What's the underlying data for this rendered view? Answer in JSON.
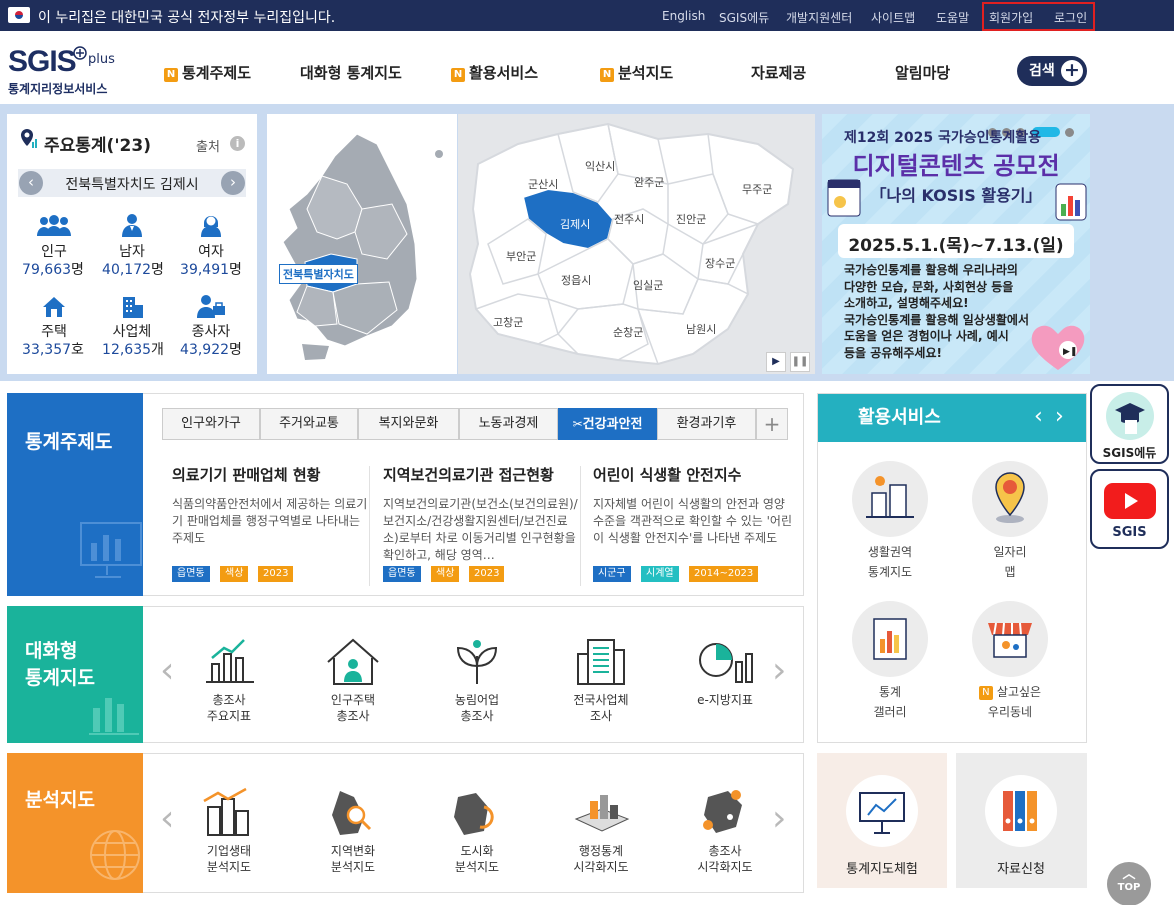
{
  "gov_banner": {
    "text": "이 누리집은 대한민국 공식 전자정부 누리집입니다."
  },
  "top_links": [
    "English",
    "SGIS에듀",
    "개발지원센터",
    "사이트맵",
    "도움말",
    "회원가입",
    "로그인"
  ],
  "logo": {
    "name": "SGIS",
    "plus": "plus",
    "subtitle": "통계지리정보서비스"
  },
  "nav": {
    "items": [
      {
        "label": "통계주제도",
        "badge": "N"
      },
      {
        "label": "대화형 통계지도",
        "badge": ""
      },
      {
        "label": "활용서비스",
        "badge": "N"
      },
      {
        "label": "분석지도",
        "badge": "N"
      },
      {
        "label": "자료제공",
        "badge": ""
      },
      {
        "label": "알림마당",
        "badge": ""
      }
    ],
    "search_label": "검색"
  },
  "stats": {
    "title": "주요통계('23)",
    "source_label": "출처",
    "info_icon": "i",
    "region": "전북특별자치도 김제시",
    "items": [
      {
        "label": "인구",
        "value": "79,663",
        "unit": "명"
      },
      {
        "label": "남자",
        "value": "40,172",
        "unit": "명"
      },
      {
        "label": "여자",
        "value": "39,491",
        "unit": "명"
      },
      {
        "label": "주택",
        "value": "33,357",
        "unit": "호"
      },
      {
        "label": "사업체",
        "value": "12,635",
        "unit": "개"
      },
      {
        "label": "종사자",
        "value": "43,922",
        "unit": "명"
      }
    ]
  },
  "map": {
    "korea_label": "전북특별자치도",
    "districts": [
      "군산시",
      "익산시",
      "완주군",
      "무주군",
      "김제시",
      "전주시",
      "진안군",
      "부안군",
      "장수군",
      "정읍시",
      "임실군",
      "고창군",
      "순창군",
      "남원시"
    ],
    "selected": "김제시"
  },
  "promo": {
    "line1": "제12회 2025 국가승인통계활용",
    "line2": "디지털콘텐츠 공모전",
    "line3": "「나의 KOSIS 활용기」",
    "date": "2025.5.1.(목)~7.13.(일)",
    "body": [
      "국가승인통계를 활용해 우리나라의",
      "다양한 모습, 문화, 사회현상 등을",
      "소개하고, 설명해주세요!",
      "국가승인통계를 활용해 일상생활에서",
      "도움을 얻은 경험이나 사례, 예시",
      "등을 공유해주세요!"
    ]
  },
  "theme": {
    "side_title": "통계주제도",
    "tabs": [
      "인구와가구",
      "주거와교통",
      "복지와문화",
      "노동과경제",
      "건강과안전",
      "환경과기후",
      "+"
    ],
    "cards": [
      {
        "title": "의료기기 판매업체 현황",
        "desc": "식품의약품안전처에서 제공하는 의료기기 판매업체를 행정구역별로 나타내는 주제도",
        "tags": [
          "읍면동",
          "색상",
          "2023"
        ]
      },
      {
        "title": "지역보건의료기관 접근현황",
        "desc": "지역보건의료기관(보건소(보건의료원)/보건지소/건강생활지원센터/보건진료소)로부터 차로 이동거리별 인구현황을 확인하고, 해당 영역…",
        "tags": [
          "읍면동",
          "색상",
          "2023"
        ]
      },
      {
        "title": "어린이 식생활 안전지수",
        "desc": "지자체별 어린이 식생활의 안전과 영양수준을 객관적으로 확인할 수 있는 '어린이 식생활 안전지수'를 나타낸 주제도",
        "tags": [
          "시군구",
          "시계열",
          "2014~2023"
        ]
      }
    ]
  },
  "interactive": {
    "side_title": [
      "대화형",
      "통계지도"
    ],
    "items": [
      [
        "총조사",
        "주요지표"
      ],
      [
        "인구주택",
        "총조사"
      ],
      [
        "농림어업",
        "총조사"
      ],
      [
        "전국사업체",
        "조사"
      ],
      [
        "e-지방지표",
        ""
      ]
    ]
  },
  "analysis": {
    "side_title": "분석지도",
    "items": [
      [
        "기업생태",
        "분석지도"
      ],
      [
        "지역변화",
        "분석지도"
      ],
      [
        "도시화",
        "분석지도"
      ],
      [
        "행정통계",
        "시각화지도"
      ],
      [
        "총조사",
        "시각화지도"
      ]
    ]
  },
  "services": {
    "title": "활용서비스",
    "items": [
      {
        "label": [
          "생활권역",
          "통계지도"
        ],
        "badge": ""
      },
      {
        "label": [
          "일자리",
          "맵"
        ],
        "badge": ""
      },
      {
        "label": [
          "통계",
          "갤러리"
        ],
        "badge": ""
      },
      {
        "label": [
          "살고싶은",
          "우리동네"
        ],
        "badge": "N"
      }
    ]
  },
  "tiles": [
    "통계지도체험",
    "자료신청"
  ],
  "floating": {
    "edu": "SGIS에듀",
    "youtube": "SGIS",
    "top": "TOP"
  },
  "colors": {
    "navy": "#1f2e5a",
    "blue": "#1e6fc4",
    "teal": "#1ab39b",
    "orange": "#f4932a",
    "cyan": "#24b0c0"
  }
}
